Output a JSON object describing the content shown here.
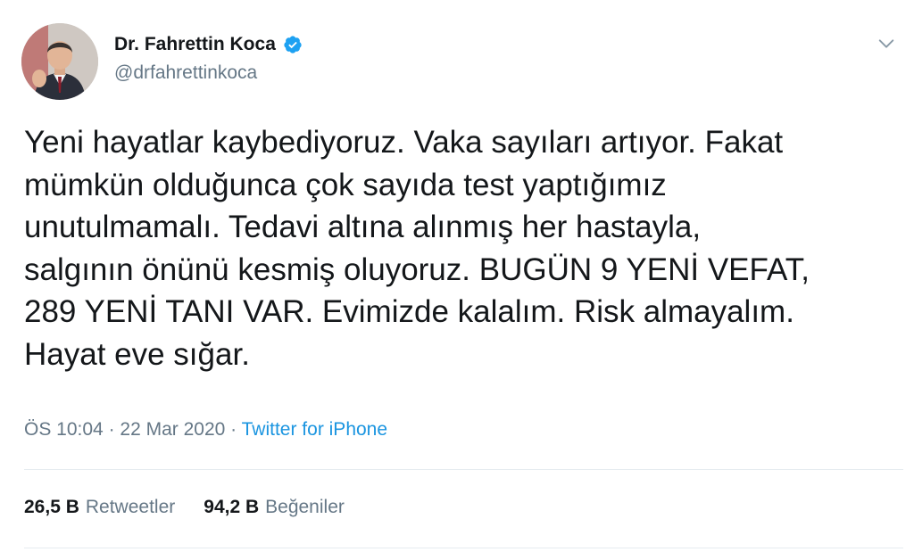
{
  "author": {
    "display_name": "Dr. Fahrettin Koca",
    "handle": "@drfahrettinkoca",
    "verified": true
  },
  "tweet": {
    "text": "Yeni hayatlar kaybediyoruz. Vaka sayıları artıyor. Fakat\nmümkün olduğunca çok sayıda test yaptığımız\nunutulmamalı. Tedavi altına alınmış her hastayla,\nsalgının önünü kesmiş oluyoruz. BUGÜN 9 YENİ VEFAT,\n289 YENİ TANI VAR. Evimizde kalalım. Risk almayalım.\nHayat eve sığar."
  },
  "meta": {
    "time": "ÖS 10:04",
    "separator": " · ",
    "date": "22 Mar 2020",
    "source": "Twitter for iPhone"
  },
  "stats": {
    "retweets_count": "26,5 B",
    "retweets_label": "Retweetler",
    "likes_count": "94,2 B",
    "likes_label": "Beğeniler"
  },
  "icons": {
    "verified": "verified-badge-icon",
    "caret": "chevron-down-icon"
  },
  "colors": {
    "verified_blue": "#1da1f2",
    "link_blue": "#1b95e0",
    "secondary_text": "#657786",
    "divider": "#e6ecf0"
  }
}
